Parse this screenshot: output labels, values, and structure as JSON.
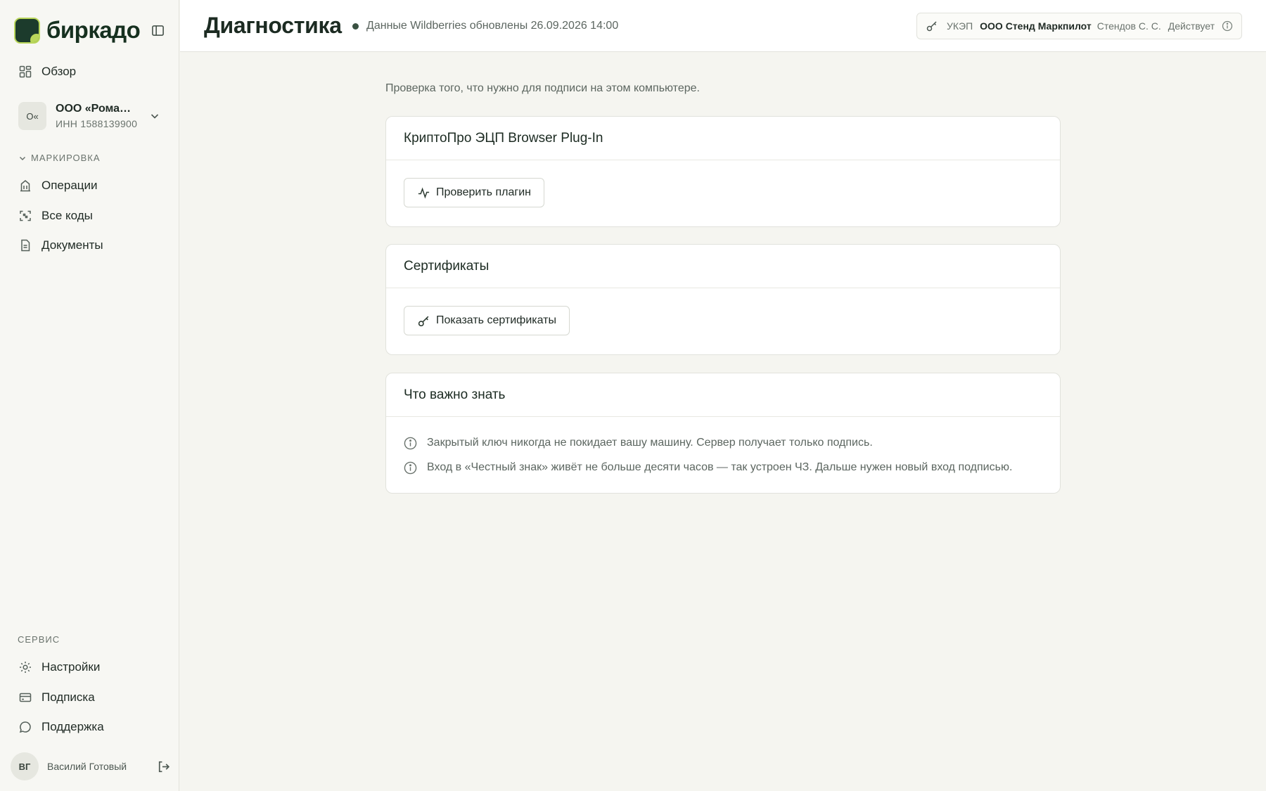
{
  "brand": {
    "name": "биркадо"
  },
  "sidebar": {
    "overview_label": "Обзор",
    "org": {
      "avatar": "О«",
      "name": "ООО «Ромашка»",
      "inn": "ИНН 1588139900"
    },
    "marking_section": "МАРКИРОВКА",
    "marking_items": [
      {
        "label": "Операции",
        "icon": "building-icon"
      },
      {
        "label": "Все коды",
        "icon": "scan-code-icon"
      },
      {
        "label": "Документы",
        "icon": "document-icon"
      }
    ],
    "service_section": "СЕРВИС",
    "service_items": [
      {
        "label": "Настройки",
        "icon": "gear-icon"
      },
      {
        "label": "Подписка",
        "icon": "credit-card-icon"
      },
      {
        "label": "Поддержка",
        "icon": "chat-bubble-icon"
      }
    ],
    "user": {
      "initials": "ВГ",
      "name": "Василий Готовый"
    }
  },
  "header": {
    "title": "Диагностика",
    "status_text": "Данные Wildberries обновлены 26.09.2026 14:00",
    "cert": {
      "type": "УКЭП",
      "org": "ООО Стенд Маркпилот",
      "owner": "Стендов С. С.",
      "state": "Действует"
    }
  },
  "main": {
    "intro": "Проверка того, что нужно для подписи на этом компьютере.",
    "plugin_card": {
      "title": "КриптоПро ЭЦП Browser Plug-In",
      "button": "Проверить плагин"
    },
    "certs_card": {
      "title": "Сертификаты",
      "button": "Показать сертификаты"
    },
    "tips_card": {
      "title": "Что важно знать",
      "tips": [
        "Закрытый ключ никогда не покидает вашу машину. Сервер получает только подпись.",
        "Вход в «Честный знак» живёт не больше десяти часов — так устроен ЧЗ. Дальше нужен новый вход подписью."
      ]
    }
  }
}
